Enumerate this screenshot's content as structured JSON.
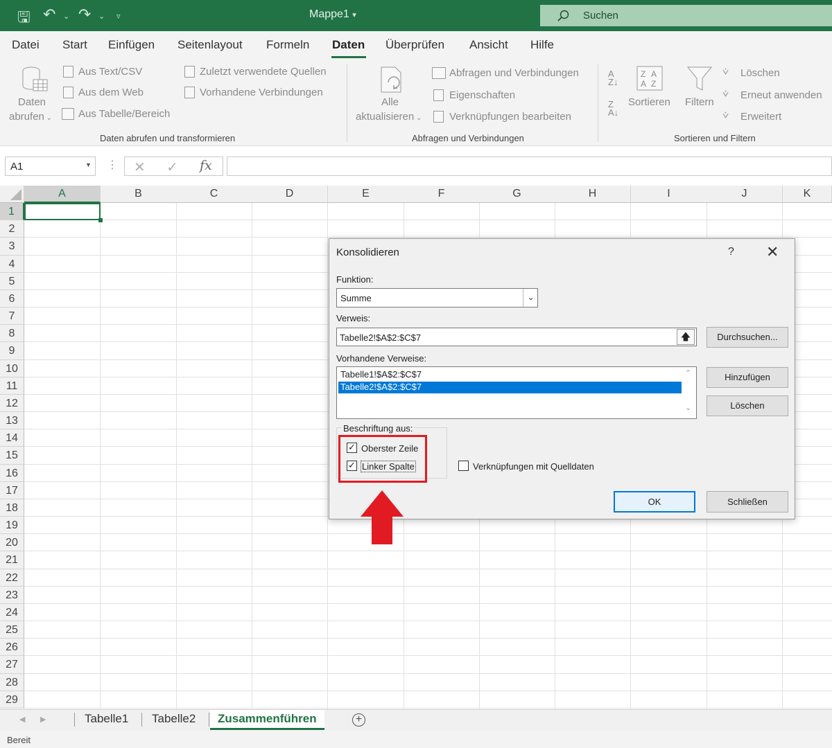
{
  "app": {
    "doc_title": "Mappe1",
    "search_placeholder": "Suchen"
  },
  "menu": [
    {
      "label": "Datei"
    },
    {
      "label": "Start"
    },
    {
      "label": "Einfügen"
    },
    {
      "label": "Seitenlayout"
    },
    {
      "label": "Formeln"
    },
    {
      "label": "Daten"
    },
    {
      "label": "Überprüfen"
    },
    {
      "label": "Ansicht"
    },
    {
      "label": "Hilfe"
    }
  ],
  "ribbon": {
    "get_data": {
      "line1": "Daten",
      "line2": "abrufen"
    },
    "from_text": "Aus Text/CSV",
    "from_web": "Aus dem Web",
    "from_table": "Aus Tabelle/Bereich",
    "recent_sources": "Zuletzt verwendete Quellen",
    "existing_connections": "Vorhandene Verbindungen",
    "group1": "Daten abrufen und transformieren",
    "refresh": {
      "line1": "Alle",
      "line2": "aktualisieren"
    },
    "queries_connections": "Abfragen und Verbindungen",
    "properties": "Eigenschaften",
    "edit_links": "Verknüpfungen bearbeiten",
    "group2": "Abfragen und Verbindungen",
    "sort": "Sortieren",
    "filter": "Filtern",
    "clear": "Löschen",
    "reapply": "Erneut anwenden",
    "advanced": "Erweitert",
    "group3": "Sortieren und Filtern"
  },
  "formula_bar": {
    "name_box": "A1",
    "fx": "fx",
    "value": ""
  },
  "columns": [
    "A",
    "B",
    "C",
    "D",
    "E",
    "F",
    "G",
    "H",
    "I",
    "J",
    "K"
  ],
  "rows": [
    "1",
    "2",
    "3",
    "4",
    "5",
    "6",
    "7",
    "8",
    "9",
    "10",
    "11",
    "12",
    "13",
    "14",
    "15",
    "16",
    "17",
    "18",
    "19",
    "20",
    "21",
    "22",
    "23",
    "24",
    "25",
    "26",
    "27",
    "28",
    "29"
  ],
  "sheets": [
    {
      "label": "Tabelle1"
    },
    {
      "label": "Tabelle2"
    },
    {
      "label": "Zusammenführen"
    }
  ],
  "status": "Bereit",
  "dialog": {
    "title": "Konsolidieren",
    "help": "?",
    "function_label": "Funktion:",
    "function_value": "Summe",
    "reference_label": "Verweis:",
    "reference_value": "Tabelle2!$A$2:$C$7",
    "browse_button": "Durchsuchen...",
    "existing_label": "Vorhandene Verweise:",
    "existing_refs": [
      "Tabelle1!$A$2:$C$7",
      "Tabelle2!$A$2:$C$7"
    ],
    "add_button": "Hinzufügen",
    "delete_button": "Löschen",
    "labels_group": "Beschriftung aus:",
    "top_row": "Oberster Zeile",
    "left_column": "Linker Spalte",
    "link_source": "Verknüpfungen mit Quelldaten",
    "ok_button": "OK",
    "close_button": "Schließen",
    "checkbox_states": {
      "top_row": true,
      "left_column": true,
      "link_source": false
    }
  },
  "colors": {
    "excel_green": "#217346",
    "highlight_red": "#e21b23",
    "selection_blue": "#0078d7"
  }
}
